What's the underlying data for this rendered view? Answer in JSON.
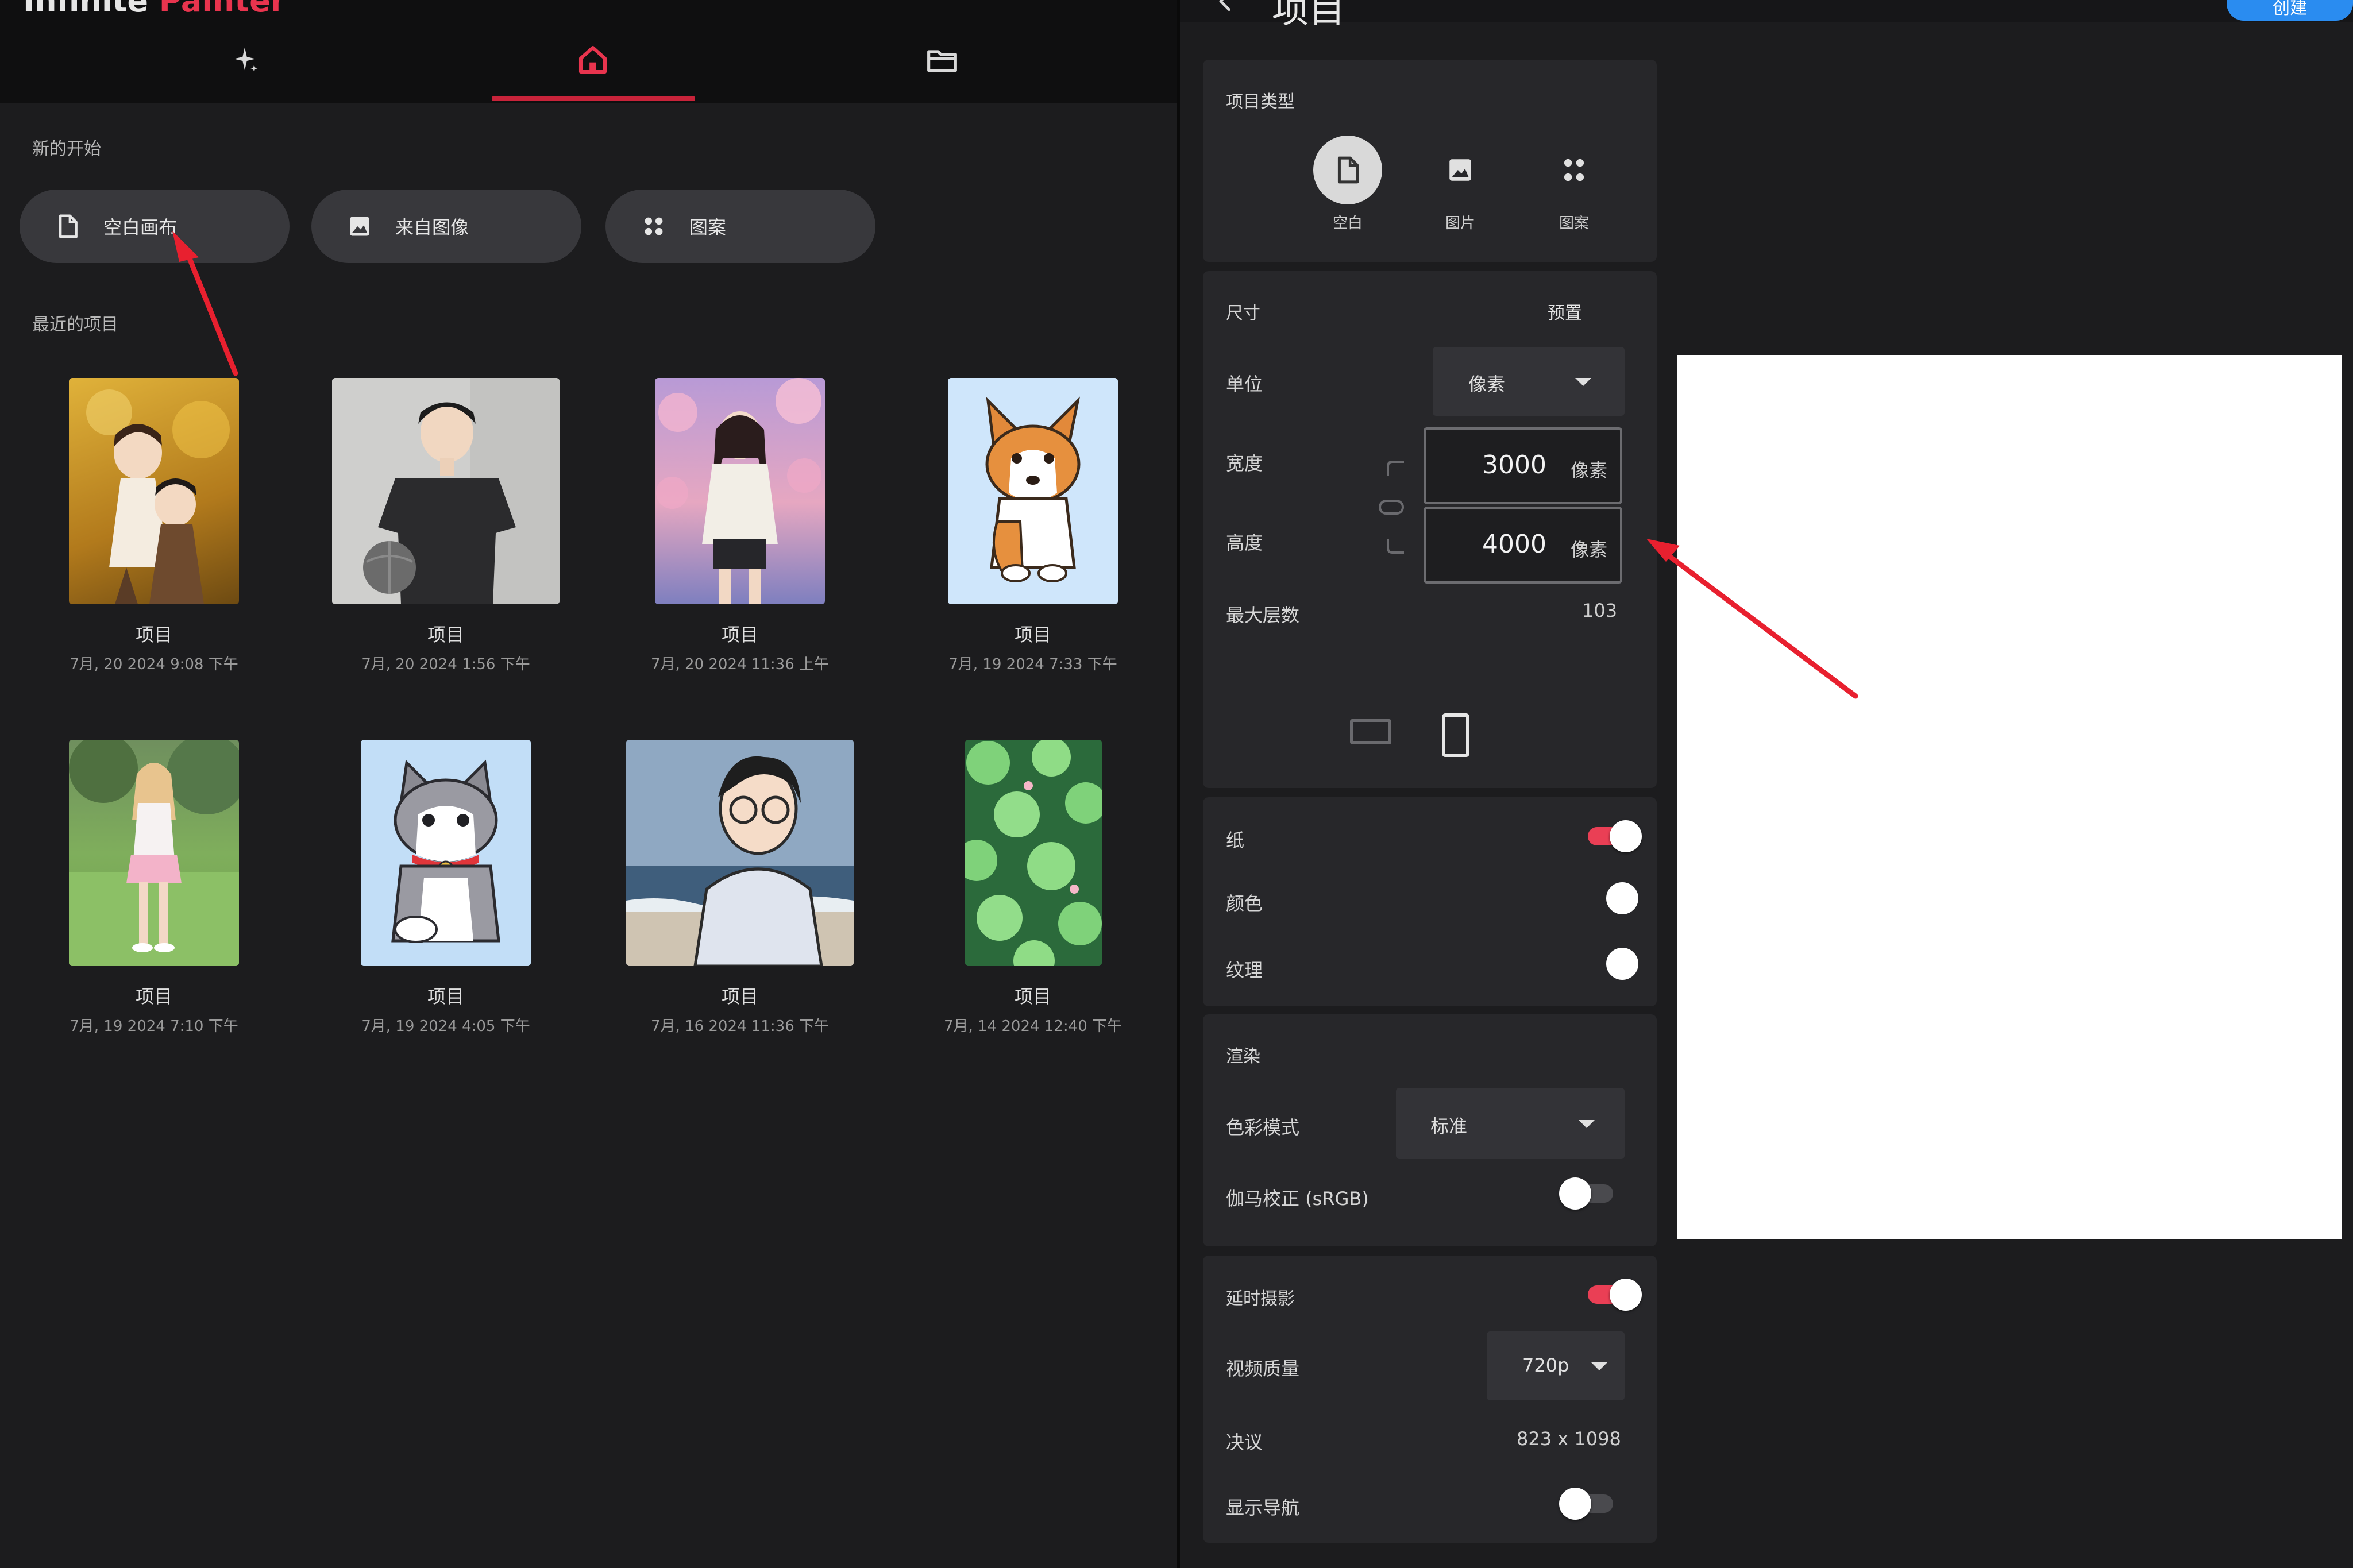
{
  "home": {
    "section_new": "新的开始",
    "section_recent": "最近的项目",
    "quick_start": [
      {
        "label": "空白画布",
        "icon": "blank-document-icon"
      },
      {
        "label": "来自图像",
        "icon": "image-icon"
      },
      {
        "label": "图案",
        "icon": "pattern-icon"
      }
    ],
    "tabs": [
      {
        "icon": "sparkle-icon"
      },
      {
        "icon": "home-icon",
        "active": true
      },
      {
        "icon": "folder-icon"
      }
    ],
    "projects": [
      {
        "title": "项目",
        "date": "7月, 20 2024 9:08 下午"
      },
      {
        "title": "项目",
        "date": "7月, 20 2024 1:56 下午"
      },
      {
        "title": "项目",
        "date": "7月, 20 2024 11:36 上午"
      },
      {
        "title": "项目",
        "date": "7月, 19 2024 7:33 下午"
      },
      {
        "title": "项目",
        "date": "7月, 19 2024 7:10 下午"
      },
      {
        "title": "项目",
        "date": "7月, 19 2024 4:05 下午"
      },
      {
        "title": "项目",
        "date": "7月, 16 2024 11:36 下午"
      },
      {
        "title": "项目",
        "date": "7月, 14 2024 12:40 下午"
      }
    ]
  },
  "dialog": {
    "title": "项目",
    "create_label": "创建",
    "project_type": {
      "title": "项目类型",
      "options": [
        {
          "label": "空白",
          "icon": "blank-document-icon",
          "active": true
        },
        {
          "label": "图片",
          "icon": "image-icon"
        },
        {
          "label": "图案",
          "icon": "pattern-icon"
        }
      ]
    },
    "size": {
      "title": "尺寸",
      "preset_label": "预置",
      "unit_label": "单位",
      "unit_value": "像素",
      "width_label": "宽度",
      "width_value": "3000",
      "width_unit": "像素",
      "height_label": "高度",
      "height_value": "4000",
      "height_unit": "像素",
      "max_layers_label": "最大层数",
      "max_layers_value": "103"
    },
    "paper": {
      "paper_label": "纸",
      "paper_on": true,
      "color_label": "颜色",
      "texture_label": "纹理"
    },
    "render": {
      "title": "渲染",
      "color_mode_label": "色彩模式",
      "color_mode_value": "标准",
      "gamma_label": "伽马校正 (sRGB)",
      "gamma_on": false
    },
    "timelapse": {
      "title": "延时摄影",
      "timelapse_on": true,
      "quality_label": "视频质量",
      "quality_value": "720p",
      "resolution_label": "决议",
      "resolution_value": "823 x 1098",
      "show_nav_label": "显示导航",
      "show_nav_on": false
    }
  },
  "colors": {
    "accent": "#e8344e",
    "primary_blue": "#2a8cf0",
    "background": "#1c1c1e",
    "card": "#27272a",
    "annotation_arrow": "#e8202f"
  }
}
